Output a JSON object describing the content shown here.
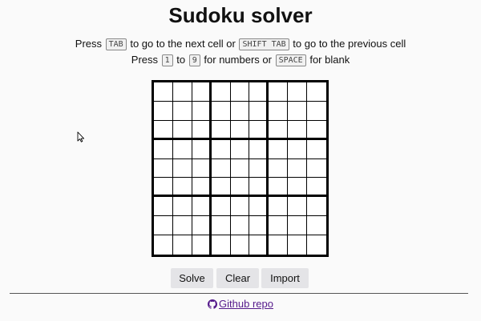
{
  "title": "Sudoku solver",
  "instructions": {
    "line1": {
      "press": "Press",
      "key1": "TAB",
      "mid": "to go to the next cell or",
      "key2": "SHIFT TAB",
      "end": "to go to the previous cell"
    },
    "line2": {
      "press": "Press",
      "key1": "1",
      "to": "to",
      "key2": "9",
      "mid": "for numbers or",
      "key3": "SPACE",
      "end": "for blank"
    }
  },
  "grid": {
    "rows": 9,
    "cols": 9,
    "values": []
  },
  "buttons": {
    "solve": "Solve",
    "clear": "Clear",
    "import": "Import"
  },
  "footer": {
    "repo_label": "Github repo",
    "icon": "github-icon",
    "link_color": "#551a8b"
  }
}
